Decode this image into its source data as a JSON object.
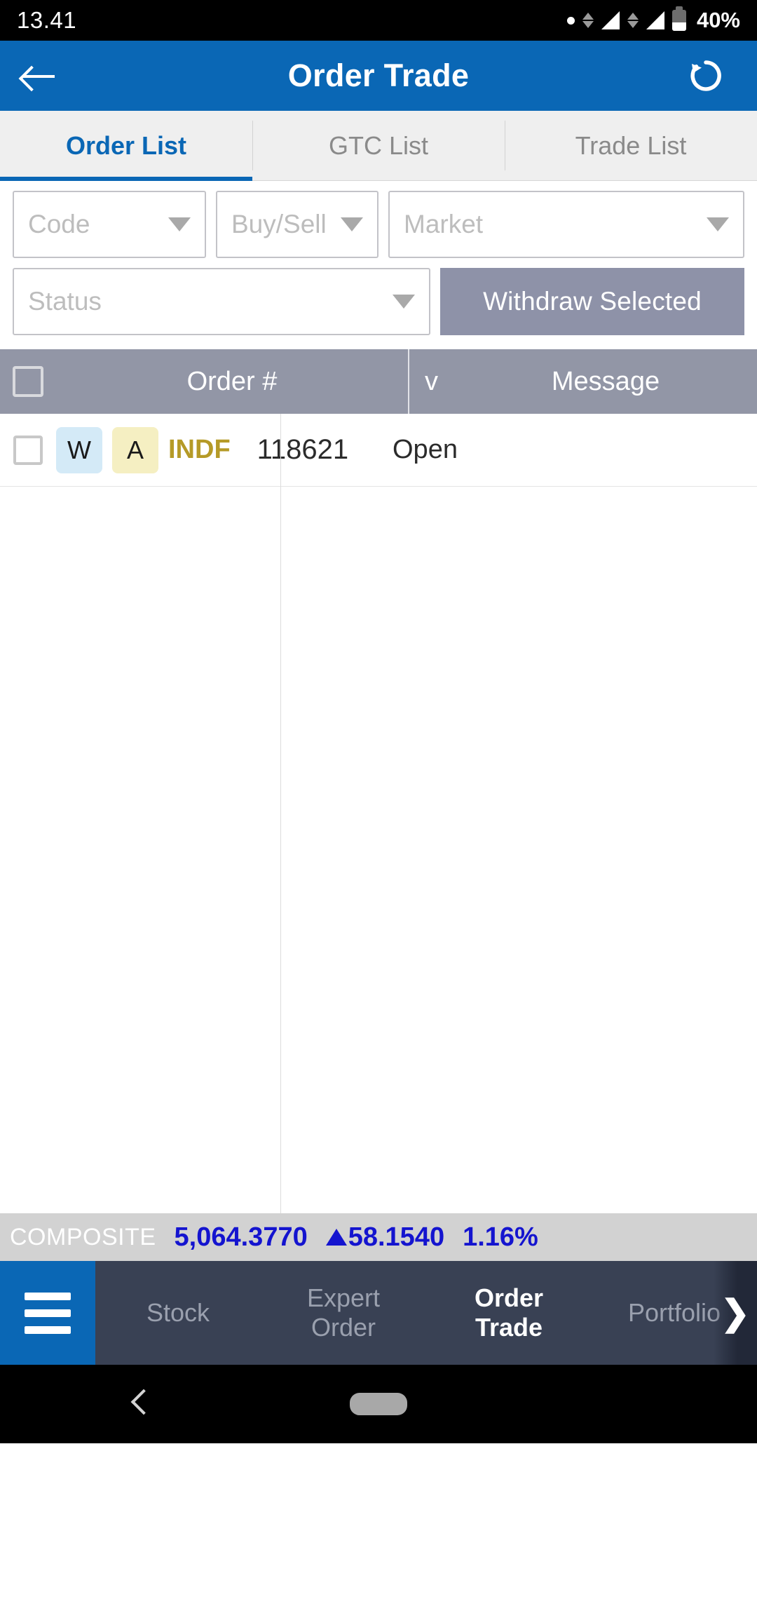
{
  "status_bar": {
    "time": "13.41",
    "battery_percent": "40%",
    "icons": [
      "dot-icon",
      "vpn-arrows-icon",
      "signal-icon",
      "vpn-arrows-icon",
      "signal-icon",
      "battery-icon"
    ]
  },
  "header": {
    "title": "Order Trade",
    "back_icon": "back-arrow-icon",
    "refresh_icon": "refresh-icon"
  },
  "tabs": [
    {
      "label": "Order List",
      "active": true
    },
    {
      "label": "GTC List",
      "active": false
    },
    {
      "label": "Trade List",
      "active": false
    }
  ],
  "filters": {
    "code": {
      "placeholder": "Code",
      "value": ""
    },
    "buy_sell": {
      "placeholder": "Buy/Sell",
      "value": ""
    },
    "market": {
      "placeholder": "Market",
      "value": ""
    },
    "status": {
      "placeholder": "Status",
      "value": ""
    },
    "withdraw_button": "Withdraw Selected"
  },
  "table": {
    "headers": {
      "select_all": "",
      "order_number": "Order #",
      "partial_column": "v",
      "message": "Message"
    },
    "rows": [
      {
        "checked": false,
        "badge_w": "W",
        "badge_a": "A",
        "code": "INDF",
        "order_number": "118621",
        "message": "Open"
      }
    ]
  },
  "composite": {
    "label": "COMPOSITE",
    "value": "5,064.3770",
    "change": "58.1540",
    "change_direction": "up",
    "percent": "1.16%"
  },
  "bottom_nav": {
    "menu_icon": "hamburger-menu-icon",
    "items": [
      {
        "label": "Stock",
        "active": false
      },
      {
        "label": "Expert\nOrder",
        "line1": "Expert",
        "line2": "Order",
        "active": false
      },
      {
        "label": "Order\nTrade",
        "line1": "Order",
        "line2": "Trade",
        "active": true
      },
      {
        "label": "Portfolio",
        "active": false
      }
    ],
    "overflow_chevron": "❯"
  },
  "colors": {
    "primary_blue": "#0a67b5",
    "header_gray": "#9296a6",
    "withdraw_gray": "#8e92a8",
    "composite_blue": "#1414cf",
    "code_gold": "#b59a27",
    "nav_dark": "#394154"
  }
}
